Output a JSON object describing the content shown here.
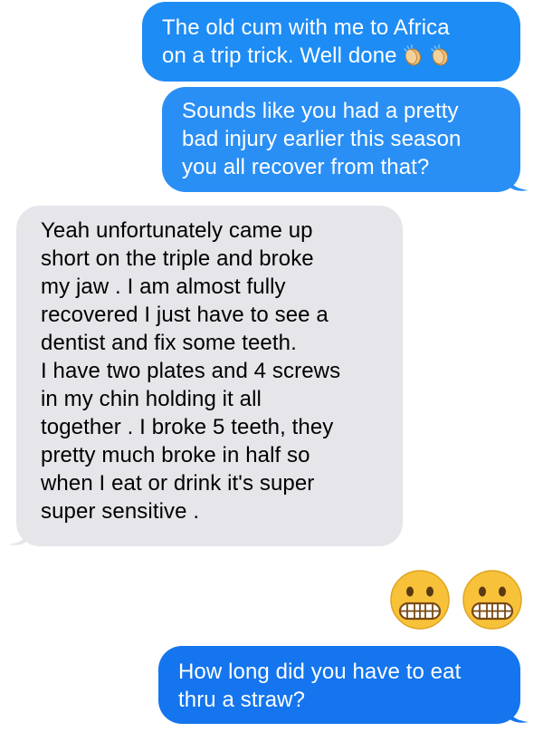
{
  "colors": {
    "sent_bubble_1": "#1e8cf5",
    "sent_bubble_2": "#2a8ff5",
    "sent_bubble_3": "#1475ee",
    "received_bubble": "#e5e5ea",
    "emoji_face": "#f7c23a",
    "emoji_outline": "#7a4a12"
  },
  "messages": [
    {
      "direction": "sent",
      "text": "The old cum with me to Africa\non a trip trick. Well done",
      "trailing_emoji": [
        "clapping-hands",
        "clapping-hands"
      ]
    },
    {
      "direction": "sent",
      "text": "Sounds like you had a pretty\nbad injury earlier this season\nyou all recover from that?"
    },
    {
      "direction": "received",
      "text": "Yeah unfortunately came up\nshort on the triple and broke\nmy jaw . I am almost fully\nrecovered I just have to see a\ndentist and fix some teeth.\nI have two plates and 4 screws\nin my chin holding it all\ntogether . I broke 5 teeth, they\npretty much broke in half so\nwhen I eat or drink it's super\nsuper sensitive ."
    },
    {
      "direction": "sent",
      "emoji": [
        "grimacing-face",
        "grimacing-face"
      ]
    },
    {
      "direction": "sent",
      "text": "How long did you have to eat\nthru a straw?"
    }
  ]
}
